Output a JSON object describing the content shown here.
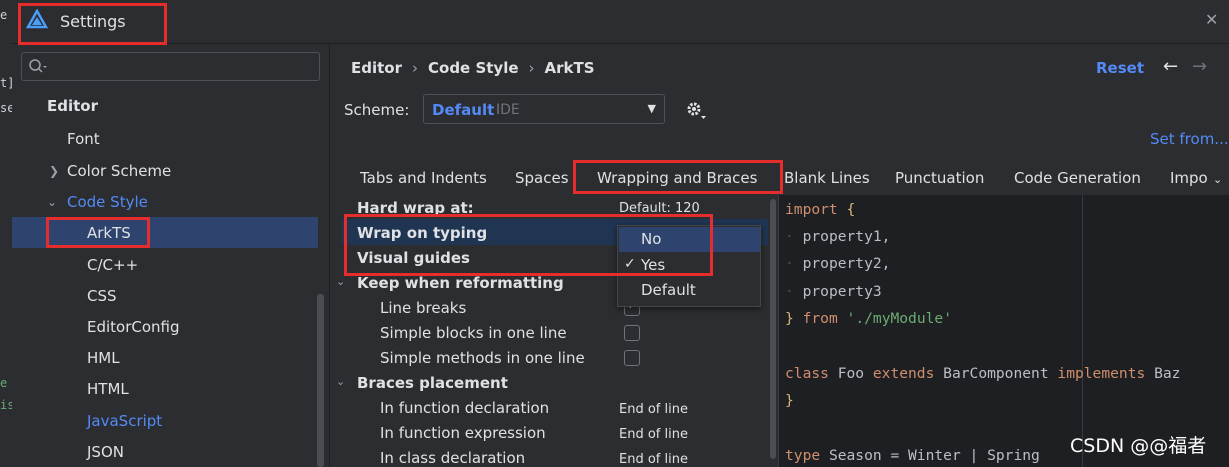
{
  "background_ide": {
    "fragments": [
      "e",
      "t]",
      "se",
      "e",
      "is"
    ]
  },
  "window": {
    "title": "Settings",
    "close_icon": "close-icon"
  },
  "sidebar": {
    "search_placeholder": "",
    "items": [
      {
        "label": "Editor"
      },
      {
        "label": "Font"
      },
      {
        "label": "Color Scheme"
      },
      {
        "label": "Code Style"
      },
      {
        "label": "ArkTS"
      },
      {
        "label": "C/C++"
      },
      {
        "label": "CSS"
      },
      {
        "label": "EditorConfig"
      },
      {
        "label": "HML"
      },
      {
        "label": "HTML"
      },
      {
        "label": "JavaScript"
      },
      {
        "label": "JSON"
      }
    ]
  },
  "header": {
    "breadcrumb": [
      "Editor",
      "Code Style",
      "ArkTS"
    ],
    "reset_label": "Reset",
    "back_glyph": "←",
    "forward_glyph": "→"
  },
  "scheme": {
    "label": "Scheme:",
    "value": "Default",
    "sublabel": "IDE"
  },
  "set_from_label": "Set from...",
  "tabs": [
    "Tabs and Indents",
    "Spaces",
    "Wrapping and Braces",
    "Blank Lines",
    "Punctuation",
    "Code Generation",
    "Impo"
  ],
  "options": {
    "hard_wrap_label": "Hard wrap at:",
    "hard_wrap_value": "Default: 120",
    "wrap_on_typing": "Wrap on typing",
    "visual_guides": "Visual guides",
    "keep_when_reformatting": "Keep when reformatting",
    "line_breaks": "Line breaks",
    "simple_blocks": "Simple blocks in one line",
    "simple_methods": "Simple methods in one line",
    "braces_placement": "Braces placement",
    "in_function_declaration": "In function declaration",
    "in_function_expression": "In function expression",
    "in_class_declaration": "In class declaration",
    "end_of_line": "End of line",
    "line_breaks_checked": true,
    "simple_blocks_checked": false,
    "simple_methods_checked": false
  },
  "popup": {
    "items": [
      "No",
      "Yes",
      "Default"
    ],
    "highlighted": "No",
    "checked": "Yes"
  },
  "code_preview": {
    "lines": [
      "import {",
      "  property1,",
      "  property2,",
      "  property3",
      "} from './myModule'",
      "",
      "class Foo extends BarComponent implements Baz",
      "}",
      "",
      "type Season = Winter | Spring"
    ]
  },
  "watermark": "CSDN @@福者",
  "colors": {
    "accent": "#548af7",
    "selection": "#2e436e",
    "annotation_red": "#e52d2d"
  }
}
